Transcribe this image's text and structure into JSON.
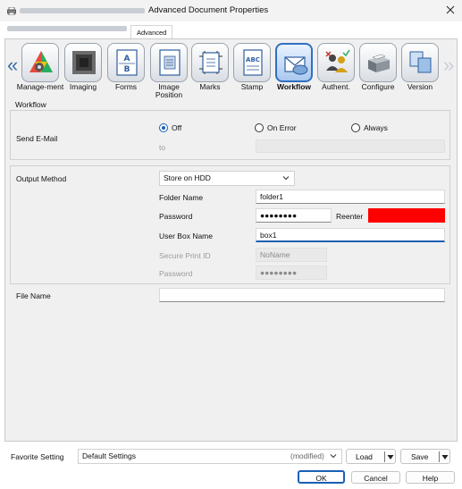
{
  "window": {
    "title": "Advanced Document Properties",
    "close_icon": "close-icon"
  },
  "tabs": [
    {
      "label": "Advanced"
    }
  ],
  "toolbar": {
    "items": [
      {
        "label": "Manage-ment",
        "icon": "management-icon"
      },
      {
        "label": "Imaging",
        "icon": "imaging-icon"
      },
      {
        "label": "Forms",
        "icon": "forms-icon"
      },
      {
        "label": "Image Position",
        "icon": "image-position-icon"
      },
      {
        "label": "Marks",
        "icon": "marks-icon"
      },
      {
        "label": "Stamp",
        "icon": "stamp-icon"
      },
      {
        "label": "Workflow",
        "icon": "workflow-icon",
        "selected": true
      },
      {
        "label": "Authent.",
        "icon": "authentication-icon"
      },
      {
        "label": "Configure",
        "icon": "configure-icon"
      },
      {
        "label": "Version",
        "icon": "version-icon"
      }
    ]
  },
  "workflow": {
    "heading": "Workflow",
    "send_email": {
      "label": "Send E-Mail",
      "options": [
        "Off",
        "On Error",
        "Always"
      ],
      "selected": "Off",
      "to_label": "to",
      "to_value": ""
    }
  },
  "output": {
    "label": "Output Method",
    "method": "Store on HDD",
    "folder_name_label": "Folder Name",
    "folder_name_value": "folder1",
    "password_label": "Password",
    "password_value": "●●●●●●●●",
    "reenter_label": "Reenter",
    "reenter_value": "",
    "user_box_label": "User Box Name",
    "user_box_value": "box1",
    "secure_print_label": "Secure Print ID",
    "secure_print_value": "NoName",
    "secure_password_label": "Password",
    "secure_password_value": "●●●●●●●●",
    "reenter_color": "#ff0000"
  },
  "file": {
    "label": "File Name",
    "value": ""
  },
  "favorite": {
    "label": "Favorite Setting",
    "value": "Default Settings",
    "modified": "(modified)",
    "load_label": "Load",
    "save_label": "Save"
  },
  "footer": {
    "ok_label": "OK",
    "cancel_label": "Cancel",
    "help_label": "Help"
  },
  "colors": {
    "accent": "#1a5fb4",
    "panel": "#f0f0f0"
  }
}
